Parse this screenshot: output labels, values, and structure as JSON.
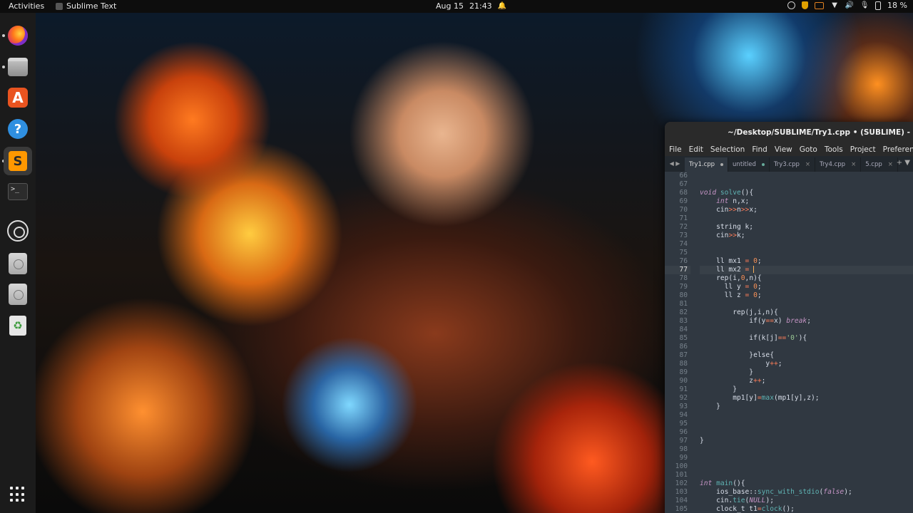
{
  "topbar": {
    "activities": "Activities",
    "app_name": "Sublime Text",
    "date": "Aug 15",
    "time": "21:43",
    "battery": "18 %"
  },
  "dock": {
    "items": [
      "Firefox",
      "Files",
      "Ubuntu Software",
      "Help",
      "Sublime Text",
      "Terminal",
      "OBS Studio",
      "Disk",
      "Disk",
      "Trash",
      "Show Applications"
    ]
  },
  "sublime": {
    "title": "~/Desktop/SUBLIME/Try1.cpp • (SUBLIME) -",
    "menu": [
      "File",
      "Edit",
      "Selection",
      "Find",
      "View",
      "Goto",
      "Tools",
      "Project",
      "Preferences"
    ],
    "tabs": [
      {
        "label": "Try1.cpp",
        "marker": "dot"
      },
      {
        "label": "untitled",
        "marker": "dot-green"
      },
      {
        "label": "Try3.cpp",
        "marker": "close"
      },
      {
        "label": "Try4.cpp",
        "marker": "close"
      },
      {
        "label": "5.cpp",
        "marker": "close"
      }
    ],
    "current_line": 77,
    "lines": [
      {
        "n": "66",
        "t": ""
      },
      {
        "n": "67",
        "t": ""
      },
      {
        "n": "68",
        "t": "void solve(){"
      },
      {
        "n": "69",
        "t": "    int n,x;"
      },
      {
        "n": "70",
        "t": "    cin>>n>>x;"
      },
      {
        "n": "71",
        "t": ""
      },
      {
        "n": "72",
        "t": "    string k;"
      },
      {
        "n": "73",
        "t": "    cin>>k;"
      },
      {
        "n": "74",
        "t": ""
      },
      {
        "n": "75",
        "t": ""
      },
      {
        "n": "76",
        "t": "    ll mx1 = 0;"
      },
      {
        "n": "77",
        "t": "    ll mx2 = "
      },
      {
        "n": "78",
        "t": "    rep(i,0,n){"
      },
      {
        "n": "79",
        "t": "      ll y = 0;"
      },
      {
        "n": "80",
        "t": "      ll z = 0;"
      },
      {
        "n": "81",
        "t": ""
      },
      {
        "n": "82",
        "t": "        rep(j,i,n){"
      },
      {
        "n": "83",
        "t": "            if(y==x) break;"
      },
      {
        "n": "84",
        "t": ""
      },
      {
        "n": "85",
        "t": "            if(k[j]=='0'){"
      },
      {
        "n": "86",
        "t": ""
      },
      {
        "n": "87",
        "t": "            }else{"
      },
      {
        "n": "88",
        "t": "                y++;"
      },
      {
        "n": "89",
        "t": "            }"
      },
      {
        "n": "90",
        "t": "            z++;"
      },
      {
        "n": "91",
        "t": "        }"
      },
      {
        "n": "92",
        "t": "        mp1[y]=max(mp1[y],z);"
      },
      {
        "n": "93",
        "t": "    }"
      },
      {
        "n": "94",
        "t": ""
      },
      {
        "n": "95",
        "t": ""
      },
      {
        "n": "96",
        "t": ""
      },
      {
        "n": "97",
        "t": "}"
      },
      {
        "n": "98",
        "t": ""
      },
      {
        "n": "99",
        "t": ""
      },
      {
        "n": "100",
        "t": ""
      },
      {
        "n": "101",
        "t": ""
      },
      {
        "n": "102",
        "t": "int main(){"
      },
      {
        "n": "103",
        "t": "    ios_base::sync_with_stdio(false);"
      },
      {
        "n": "104",
        "t": "    cin.tie(NULL);"
      },
      {
        "n": "105",
        "t": "    clock_t t1=clock();"
      }
    ]
  }
}
